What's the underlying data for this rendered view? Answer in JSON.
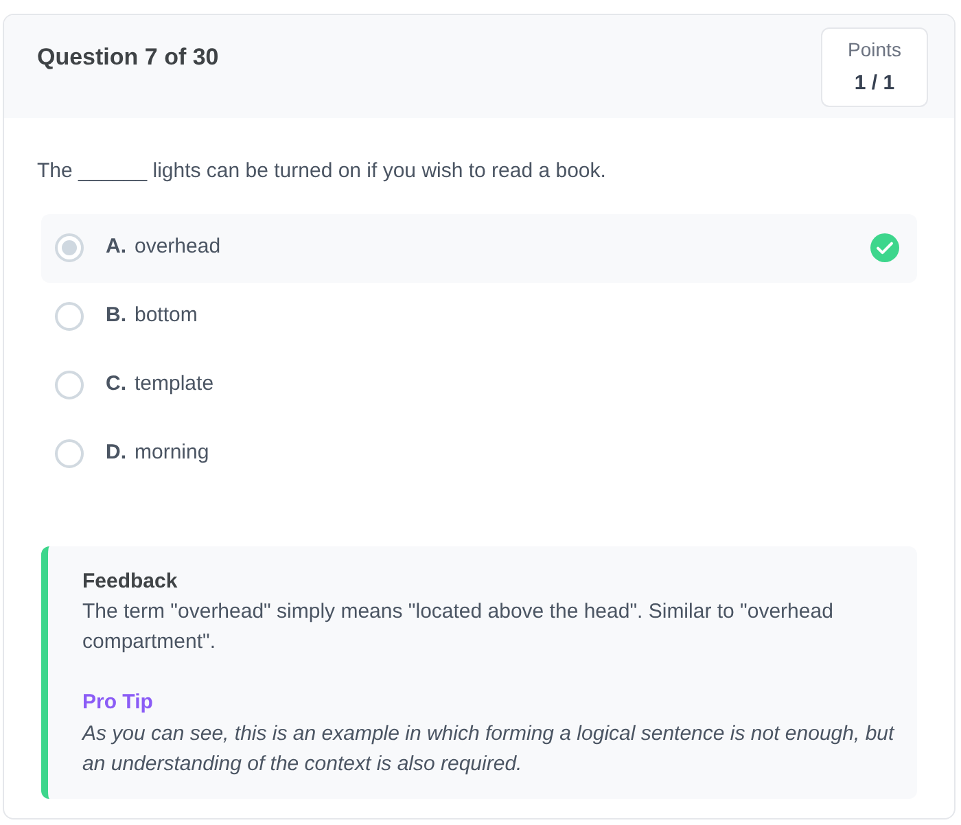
{
  "header": {
    "title": "Question 7 of 30",
    "points_label": "Points",
    "points_value": "1 / 1"
  },
  "question": "The ______ lights can be turned on if you wish to read a book.",
  "options": [
    {
      "letter": "A.",
      "text": "overhead",
      "selected": true,
      "correct": true
    },
    {
      "letter": "B.",
      "text": "bottom",
      "selected": false,
      "correct": false
    },
    {
      "letter": "C.",
      "text": "template",
      "selected": false,
      "correct": false
    },
    {
      "letter": "D.",
      "text": "morning",
      "selected": false,
      "correct": false
    }
  ],
  "feedback": {
    "title": "Feedback",
    "text": "The term \"overhead\" simply means \"located above the head\". Similar to \"overhead compartment\".",
    "tip_title": "Pro Tip",
    "tip_text": "As you can see, this is an example in which forming a logical sentence is not enough, but an understanding of the context is also required."
  }
}
